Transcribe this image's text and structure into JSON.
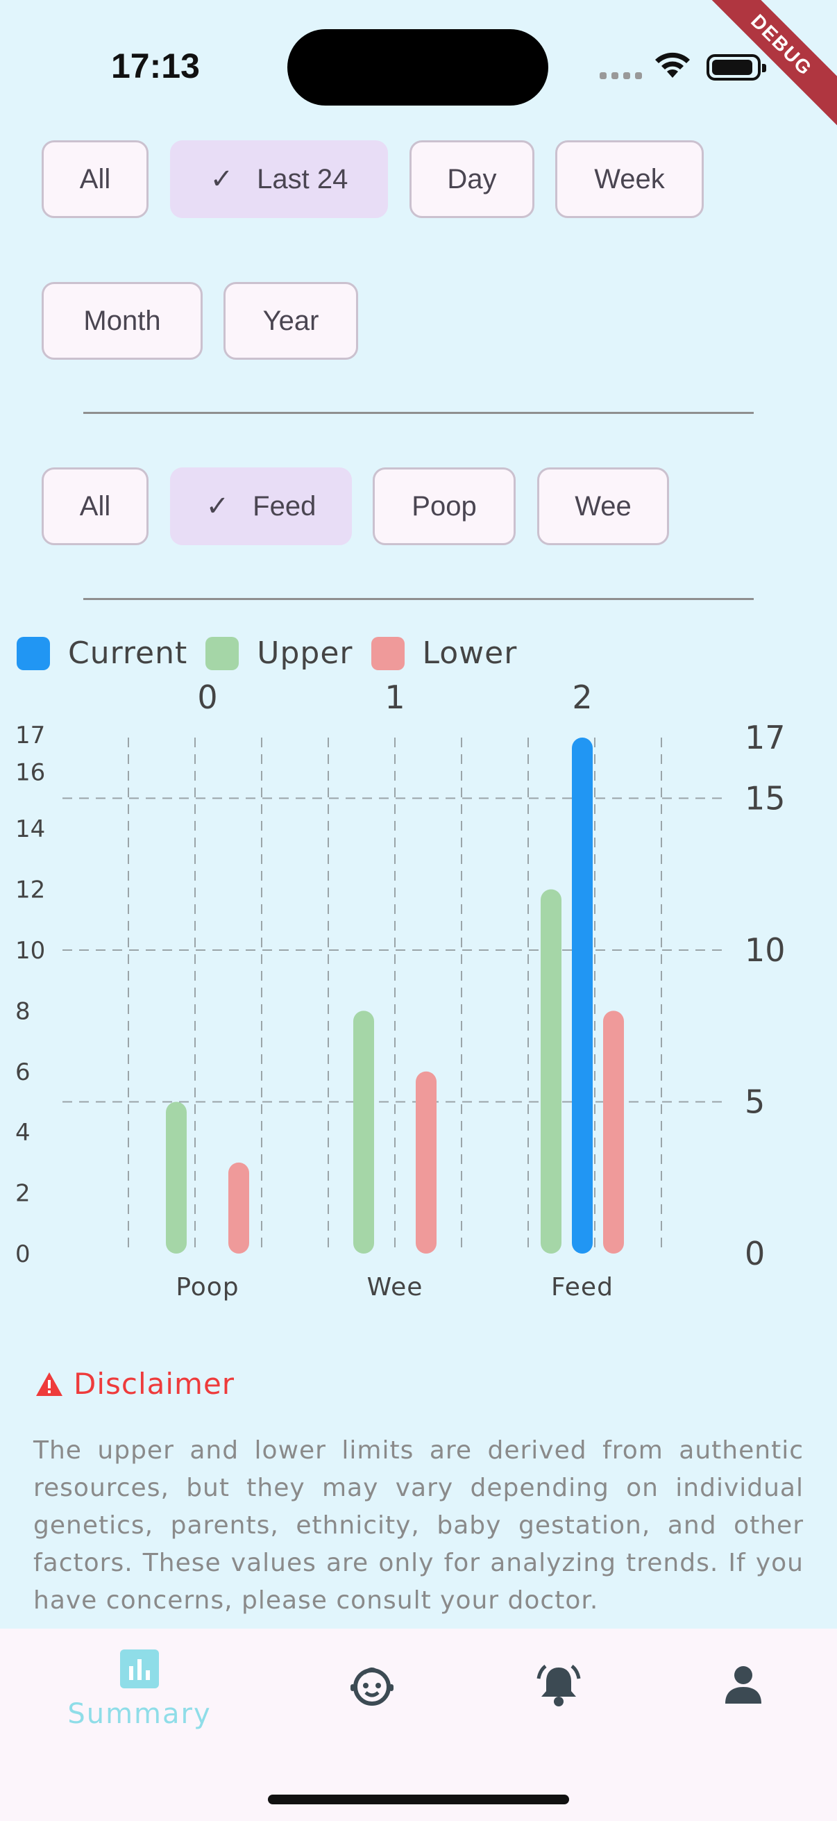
{
  "status_bar": {
    "time": "17:13",
    "debug_label": "DEBUG"
  },
  "time_filters": {
    "chips": [
      {
        "label": "All",
        "selected": false
      },
      {
        "label": "Last 24",
        "selected": true
      },
      {
        "label": "Day",
        "selected": false
      },
      {
        "label": "Week",
        "selected": false
      },
      {
        "label": "Month",
        "selected": false
      },
      {
        "label": "Year",
        "selected": false
      }
    ]
  },
  "type_filters": {
    "chips": [
      {
        "label": "All",
        "selected": false
      },
      {
        "label": "Feed",
        "selected": true
      },
      {
        "label": "Poop",
        "selected": false
      },
      {
        "label": "Wee",
        "selected": false
      }
    ]
  },
  "legend": {
    "items": [
      {
        "label": "Current",
        "color": "#2196f3"
      },
      {
        "label": "Upper",
        "color": "#a5d6a7"
      },
      {
        "label": "Lower",
        "color": "#ef9a9a"
      }
    ]
  },
  "chart_data": {
    "type": "bar",
    "categories": [
      "Poop",
      "Wee",
      "Feed"
    ],
    "top_labels": [
      "0",
      "1",
      "2"
    ],
    "series": [
      {
        "name": "Upper",
        "color": "#a5d6a7",
        "values": [
          5,
          8,
          12
        ]
      },
      {
        "name": "Current",
        "color": "#2196f3",
        "values": [
          0,
          0,
          17
        ]
      },
      {
        "name": "Lower",
        "color": "#ef9a9a",
        "values": [
          3,
          6,
          8
        ]
      }
    ],
    "left_ticks": [
      "0",
      "2",
      "4",
      "6",
      "8",
      "10",
      "12",
      "14",
      "16",
      "17"
    ],
    "right_ticks": [
      "0",
      "5",
      "10",
      "15",
      "17"
    ],
    "ylim": [
      0,
      17
    ],
    "grid": true
  },
  "disclaimer": {
    "title": "Disclaimer",
    "text": "The upper and lower limits are derived from authentic resources, but they may vary depending on individual genetics, parents, ethnicity, baby gestation, and other factors. These values are only for analyzing trends. If you have concerns, please consult your doctor."
  },
  "bottom_nav": {
    "items": [
      {
        "label": "Summary",
        "icon": "bar-chart-icon",
        "active": true
      },
      {
        "label": "",
        "icon": "baby-face-icon",
        "active": false
      },
      {
        "label": "",
        "icon": "bell-icon",
        "active": false
      },
      {
        "label": "",
        "icon": "person-icon",
        "active": false
      }
    ],
    "active_color": "#8fdde8",
    "inactive_color": "#3c4a53"
  }
}
